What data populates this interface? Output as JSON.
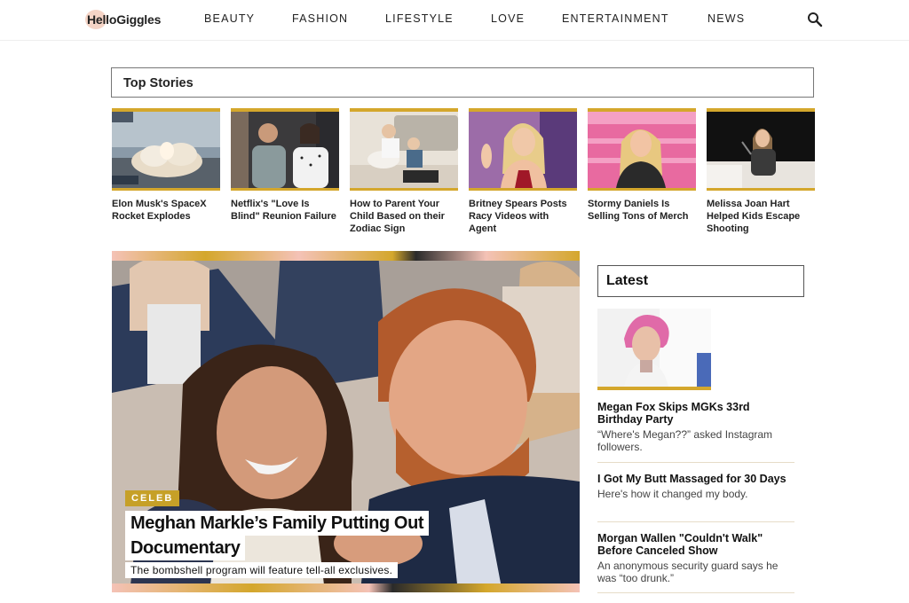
{
  "header": {
    "logo": "HelloGiggles",
    "nav": [
      "BEAUTY",
      "FASHION",
      "LIFESTYLE",
      "LOVE",
      "ENTERTAINMENT",
      "NEWS"
    ],
    "search_icon": "search-icon"
  },
  "top_stories": {
    "heading": "Top Stories",
    "items": [
      {
        "title": "Elon Musk's SpaceX Rocket Explodes"
      },
      {
        "title": "Netflix's \"Love Is Blind\" Reunion Failure"
      },
      {
        "title": "How to Parent Your Child Based on their Zodiac Sign"
      },
      {
        "title": "Britney Spears Posts Racy Videos with Agent"
      },
      {
        "title": "Stormy Daniels Is Selling Tons of Merch"
      },
      {
        "title": "Melissa Joan Hart Helped Kids Escape Shooting"
      }
    ]
  },
  "hero": {
    "tag": "CELEB",
    "headline_line1": "Meghan Markle’s Family Putting Out",
    "headline_line2": "Documentary",
    "dek": "The bombshell program will feature tell-all exclusives."
  },
  "latest": {
    "heading": "Latest",
    "items": [
      {
        "title": "Megan Fox Skips MGKs 33rd Birthday Party",
        "dek": "“Where's Megan??” asked Instagram followers."
      },
      {
        "title": "I Got My Butt Massaged for 30 Days",
        "dek": "Here's how it changed my body."
      },
      {
        "title": "Morgan Wallen \"Couldn't Walk\" Before Canceled Show",
        "dek": "An anonymous security guard says he was “too drunk.”"
      }
    ]
  },
  "colors": {
    "accent_gold": "#d4a72c",
    "accent_pink": "#f4c2b6",
    "tag_gold": "#c6a028"
  }
}
